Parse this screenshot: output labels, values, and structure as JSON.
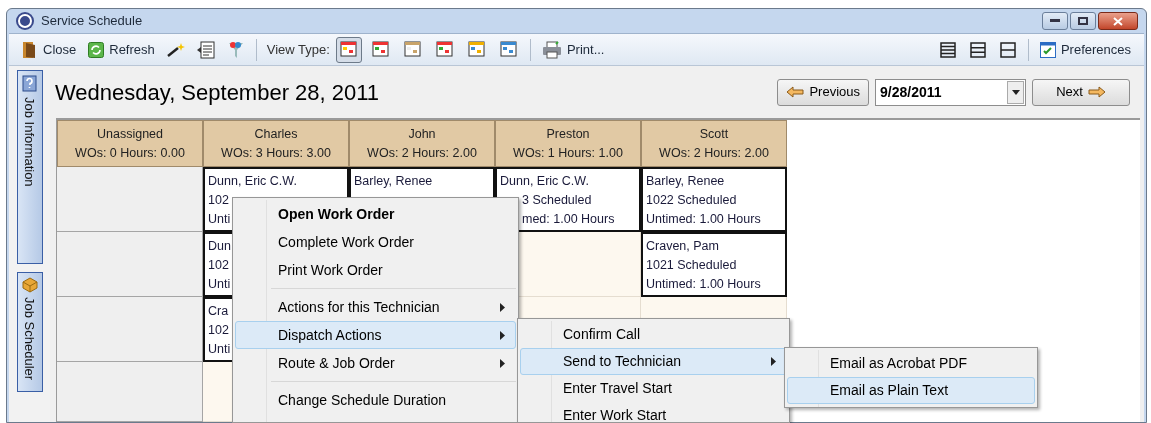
{
  "window": {
    "title": "Service Schedule"
  },
  "toolbar": {
    "items": [
      {
        "kind": "button",
        "label": "Close"
      },
      {
        "kind": "button",
        "label": "Refresh"
      },
      {
        "kind": "icon"
      },
      {
        "kind": "icon"
      },
      {
        "kind": "icon"
      },
      {
        "kind": "separator"
      },
      {
        "kind": "label",
        "label": "View Type:"
      },
      {
        "kind": "view",
        "selected": true
      },
      {
        "kind": "view",
        "selected": false
      },
      {
        "kind": "view",
        "selected": false
      },
      {
        "kind": "view",
        "selected": false
      },
      {
        "kind": "view",
        "selected": false
      },
      {
        "kind": "view",
        "selected": false
      },
      {
        "kind": "separator"
      },
      {
        "kind": "button",
        "label": "Print..."
      }
    ],
    "right_items": [
      {
        "kind": "icon"
      },
      {
        "kind": "icon"
      },
      {
        "kind": "icon"
      },
      {
        "kind": "separator"
      },
      {
        "kind": "button",
        "label": "Preferences"
      }
    ]
  },
  "side_tabs": [
    {
      "label": "Job Information"
    },
    {
      "label": "Job Scheduler"
    }
  ],
  "heading": "Wednesday, September 28, 2011",
  "date_nav": {
    "previous": "Previous",
    "date": "9/28/2011",
    "next": "Next"
  },
  "schedule": {
    "columns": [
      {
        "technician": "Unassigned",
        "summary": "WOs: 0 Hours: 0.00",
        "slots": [
          {
            "kind": "empty"
          },
          {
            "kind": "empty"
          },
          {
            "kind": "empty"
          },
          {
            "kind": "empty"
          }
        ]
      },
      {
        "technician": "Charles",
        "summary": "WOs: 3 Hours: 3.00",
        "slots": [
          {
            "kind": "job",
            "lines": [
              "Dunn, Eric C.W.",
              "102",
              "Unti"
            ]
          },
          {
            "kind": "job",
            "lines": [
              "Dun",
              "102",
              "Unti"
            ]
          },
          {
            "kind": "job",
            "lines": [
              "Cra",
              "102",
              "Unti"
            ]
          },
          {
            "kind": "open"
          }
        ]
      },
      {
        "technician": "John",
        "summary": "WOs: 2 Hours: 2.00",
        "slots": [
          {
            "kind": "job",
            "lines": [
              "Barley, Renee"
            ]
          }
        ]
      },
      {
        "technician": "Preston",
        "summary": "WOs: 1 Hours: 1.00",
        "slots": [
          {
            "kind": "job",
            "lines": [
              "Dunn, Eric C.W.",
              "3 Scheduled",
              "med: 1.00 Hours"
            ],
            "covered_left": true
          },
          {
            "kind": "open"
          },
          {
            "kind": "open"
          }
        ]
      },
      {
        "technician": "Scott",
        "summary": "WOs: 2 Hours: 2.00",
        "slots": [
          {
            "kind": "job",
            "lines": [
              "Barley, Renee",
              "1022 Scheduled",
              "Untimed: 1.00 Hours"
            ]
          },
          {
            "kind": "job",
            "lines": [
              "Craven, Pam",
              "1021 Scheduled",
              "Untimed: 1.00 Hours"
            ]
          },
          {
            "kind": "open"
          }
        ]
      }
    ]
  },
  "context_menu": {
    "items": [
      {
        "kind": "item",
        "label": "Open Work Order",
        "bold": true,
        "submenu": false,
        "selected": false
      },
      {
        "kind": "item",
        "label": "Complete Work Order",
        "bold": false,
        "submenu": false,
        "selected": false
      },
      {
        "kind": "item",
        "label": "Print Work Order",
        "bold": false,
        "submenu": false,
        "selected": false
      },
      {
        "kind": "separator"
      },
      {
        "kind": "item",
        "label": "Actions for this Technician",
        "bold": false,
        "submenu": true,
        "selected": false
      },
      {
        "kind": "item",
        "label": "Dispatch Actions",
        "bold": false,
        "submenu": true,
        "selected": true
      },
      {
        "kind": "item",
        "label": "Route & Job Order",
        "bold": false,
        "submenu": true,
        "selected": false
      },
      {
        "kind": "separator"
      },
      {
        "kind": "item",
        "label": "Change Schedule Duration",
        "bold": false,
        "submenu": false,
        "selected": false
      }
    ]
  },
  "dispatch_menu": {
    "items": [
      {
        "kind": "item",
        "label": "Confirm Call",
        "bold": false,
        "submenu": false,
        "selected": false
      },
      {
        "kind": "item",
        "label": "Send to Technician",
        "bold": false,
        "submenu": true,
        "selected": true
      },
      {
        "kind": "item",
        "label": "Enter Travel Start",
        "bold": false,
        "submenu": false,
        "selected": false
      },
      {
        "kind": "item",
        "label": "Enter Work Start",
        "bold": false,
        "submenu": false,
        "selected": false
      }
    ]
  },
  "send_menu": {
    "items": [
      {
        "kind": "item",
        "label": "Email as Acrobat PDF",
        "bold": false,
        "submenu": false,
        "selected": false
      },
      {
        "kind": "item",
        "label": "Email as Plain Text",
        "bold": false,
        "submenu": false,
        "selected": true
      }
    ]
  }
}
